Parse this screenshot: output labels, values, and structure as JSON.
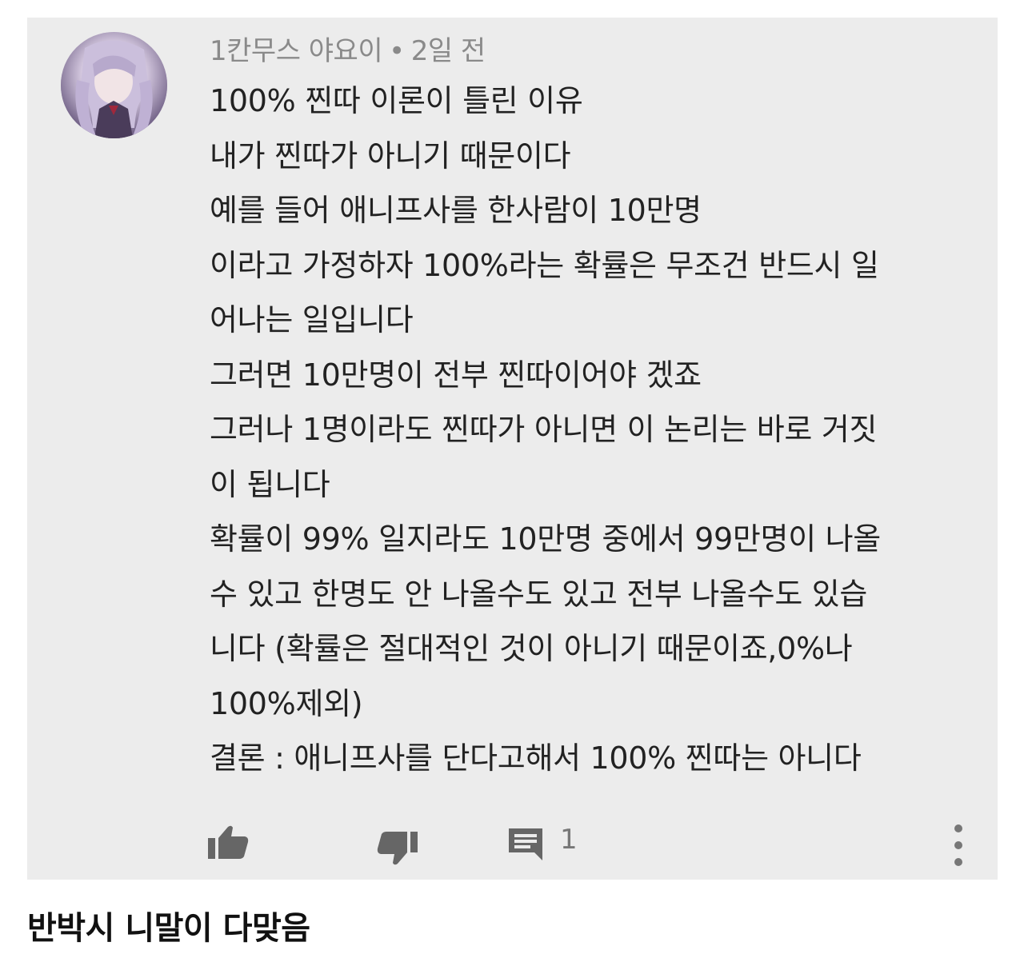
{
  "comment": {
    "author": "1칸무스 야요이",
    "separator": "•",
    "time": "2일 전",
    "lines": [
      "100% 찐따 이론이 틀린 이유",
      "내가 찐따가 아니기 때문이다",
      "예를 들어 애니프사를 한사람이 10만명",
      "이라고 가정하자 100%라는 확률은 무조건 반드시 일",
      "어나는 일입니다",
      "그러면 10만명이 전부 찐따이어야 겠죠",
      "그러나 1명이라도 찐따가 아니면 이 논리는 바로 거짓",
      "이 됩니다",
      "확률이 99% 일지라도 10만명 중에서 99만명이 나올",
      "수 있고 한명도 안 나올수도 있고 전부 나올수도 있습",
      "니다 (확률은 절대적인 것이 아니기 때문이죠,0%나",
      "100%제외)",
      "결론 : 애니프사를 단다고해서 100% 찐따는 아니다"
    ],
    "reply_count": "1",
    "icons": {
      "like": "thumbs-up-icon",
      "dislike": "thumbs-down-icon",
      "reply": "comment-icon",
      "more": "more-vertical-icon",
      "avatar": "anime-avatar"
    }
  },
  "caption": "반박시 니말이 다맞음",
  "colors": {
    "card_background": "#ececec",
    "meta_text": "#8a8a8a",
    "body_text": "#222222",
    "icon": "#666666"
  }
}
